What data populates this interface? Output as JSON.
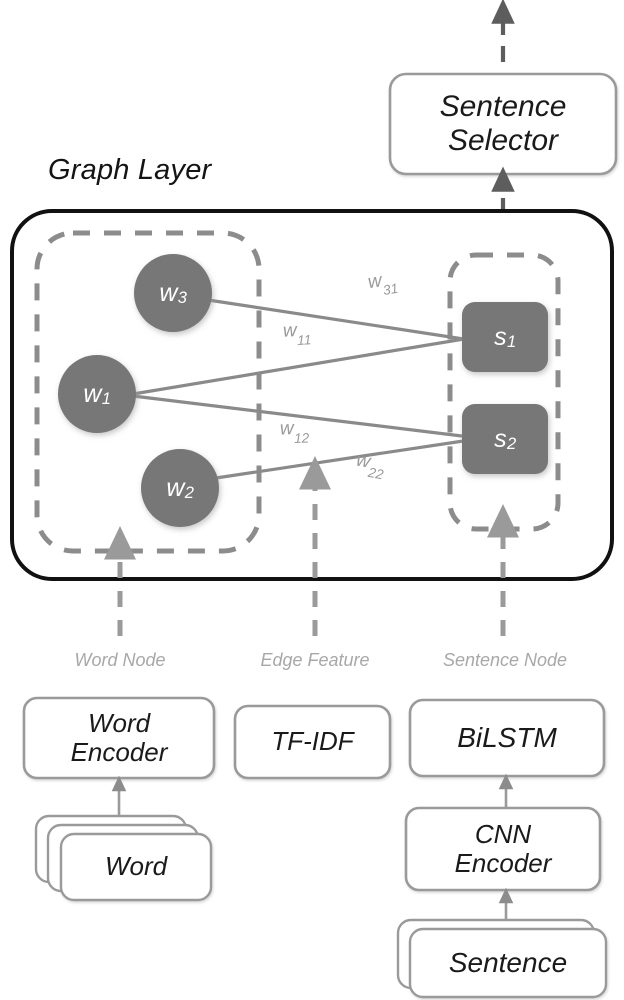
{
  "diagram": {
    "title": "Graph Layer",
    "top_module": {
      "label": "Sentence\nSelector",
      "line1": "Sentence",
      "line2": "Selector"
    },
    "word_nodes": [
      {
        "id": "w3",
        "base": "w",
        "sub": "3"
      },
      {
        "id": "w1",
        "base": "w",
        "sub": "1"
      },
      {
        "id": "w2",
        "base": "w",
        "sub": "2"
      }
    ],
    "sentence_nodes": [
      {
        "id": "s1",
        "base": "s",
        "sub": "1"
      },
      {
        "id": "s2",
        "base": "s",
        "sub": "2"
      }
    ],
    "edges": [
      {
        "id": "w31",
        "base": "w",
        "sub": "31",
        "from": "w3",
        "to": "s1"
      },
      {
        "id": "w11",
        "base": "w",
        "sub": "11",
        "from": "w1",
        "to": "s1"
      },
      {
        "id": "w12",
        "base": "w",
        "sub": "12",
        "from": "w1",
        "to": "s2"
      },
      {
        "id": "w22",
        "base": "w",
        "sub": "22",
        "from": "w2",
        "to": "s2"
      }
    ],
    "input_labels": [
      {
        "id": "word-node",
        "text": "Word Node"
      },
      {
        "id": "edge-feature",
        "text": "Edge Feature"
      },
      {
        "id": "sentence-node",
        "text": "Sentence Node"
      }
    ],
    "modules": {
      "word_encoder": {
        "line1": "Word",
        "line2": "Encoder"
      },
      "word_input": {
        "line1": "Word"
      },
      "tfidf": {
        "line1": "TF-IDF"
      },
      "bilstm": {
        "line1": "BiLSTM"
      },
      "cnn_encoder": {
        "line1": "CNN",
        "line2": "Encoder"
      },
      "sentence_input": {
        "line1": "Sentence"
      }
    },
    "colors": {
      "node_fill": "#777777",
      "outer_border": "#000000",
      "dashed_group": "#8c8c8c",
      "edge_line": "#8a8a8a",
      "box_border": "#9a9a9a",
      "label_gray": "#a8a8a8",
      "arrow_gray": "#8c8c8c",
      "text_dark": "#1a1a1a",
      "background": "#ffffff"
    }
  }
}
